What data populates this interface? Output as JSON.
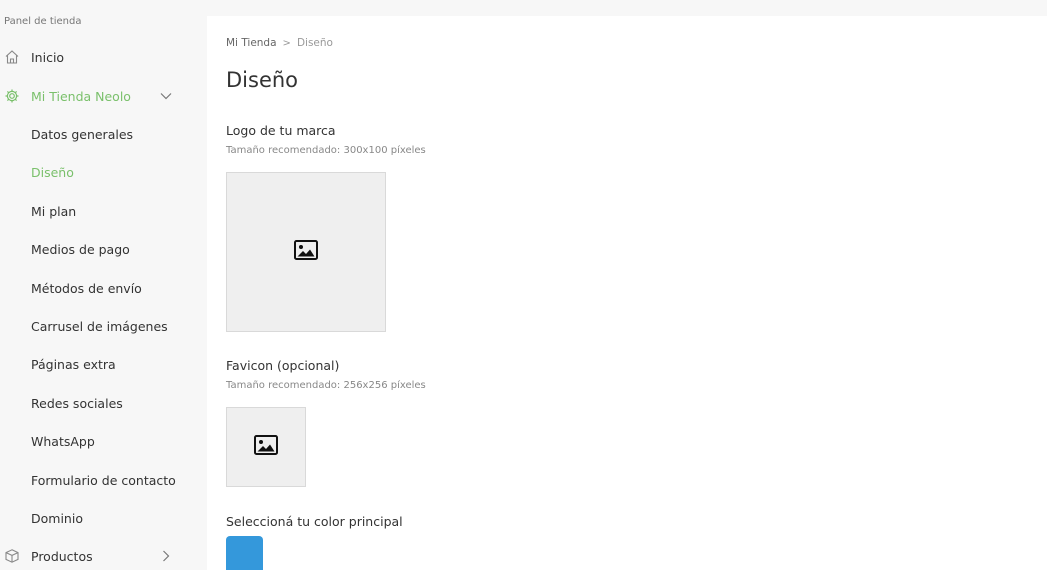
{
  "sidebar": {
    "header": "Panel de tienda",
    "inicio": "Inicio",
    "store": "Mi Tienda Neolo",
    "items": [
      "Datos generales",
      "Diseño",
      "Mi plan",
      "Medios de pago",
      "Métodos de envío",
      "Carrusel de imágenes",
      "Páginas extra",
      "Redes sociales",
      "WhatsApp",
      "Formulario de contacto",
      "Dominio"
    ],
    "productos": "Productos",
    "accent_color": "#7ac06b"
  },
  "breadcrumb": {
    "root": "Mi Tienda",
    "separator": ">",
    "current": "Diseño"
  },
  "page": {
    "title": "Diseño",
    "logo_title": "Logo de tu marca",
    "logo_hint": "Tamaño recomendado: 300x100 píxeles",
    "favicon_title": "Favicon (opcional)",
    "favicon_hint": "Tamaño recomendado: 256x256 píxeles",
    "color_title": "Seleccioná tu color principal",
    "primary_color": "#3498db"
  }
}
